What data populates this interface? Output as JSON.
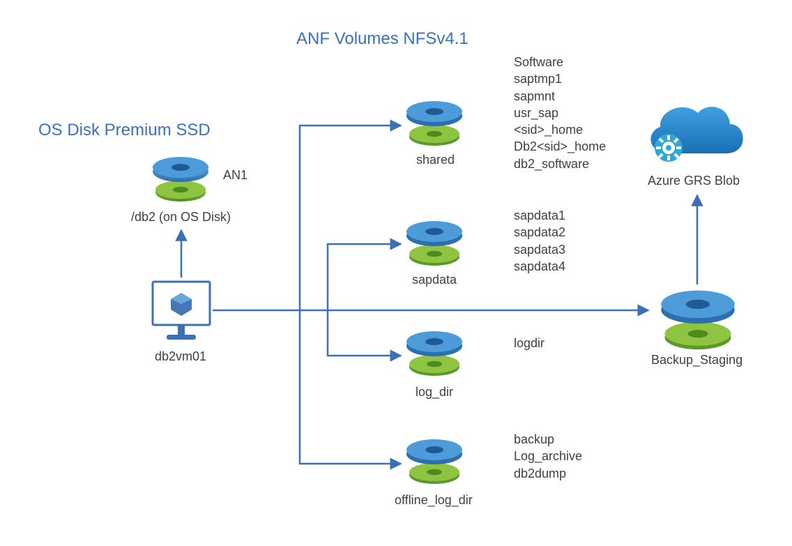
{
  "titles": {
    "left": "OS Disk Premium SSD",
    "right": "ANF Volumes NFSv4.1"
  },
  "os_disk": {
    "note": "AN1",
    "path": "/db2 (on OS Disk)"
  },
  "vm": {
    "name": "db2vm01"
  },
  "anf": {
    "shared": {
      "name": "shared",
      "contents": [
        "Software",
        "saptmp1",
        "sapmnt",
        "usr_sap",
        "<sid>_home",
        "Db2<sid>_home",
        "db2_software"
      ]
    },
    "sapdata": {
      "name": "sapdata",
      "contents": [
        "sapdata1",
        "sapdata2",
        "sapdata3",
        "sapdata4"
      ]
    },
    "log_dir": {
      "name": "log_dir",
      "contents": [
        "logdir"
      ]
    },
    "offline_log_dir": {
      "name": "offline_log_dir",
      "contents": [
        "backup",
        "Log_archive",
        "db2dump"
      ]
    }
  },
  "backup": {
    "name": "Backup_Staging"
  },
  "blob": {
    "name": "Azure GRS Blob"
  },
  "colors": {
    "stroke": "#3b6fb6",
    "blue_top": "#4d9cd9",
    "blue_bottom": "#326fb0",
    "green_top": "#8fc442",
    "green_bottom": "#5a9a29",
    "cloud_top": "#3a9bdc",
    "cloud_bottom": "#1a6fb5"
  }
}
